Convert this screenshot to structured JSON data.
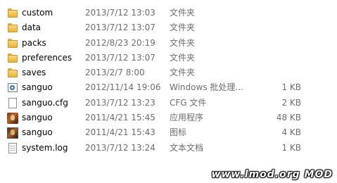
{
  "files": [
    {
      "name": "custom",
      "date": "2013/7/12 13:03",
      "type": "文件夹",
      "size": "",
      "icon": "folder-icon"
    },
    {
      "name": "data",
      "date": "2013/7/12 13:07",
      "type": "文件夹",
      "size": "",
      "icon": "folder-icon"
    },
    {
      "name": "packs",
      "date": "2012/8/23 20:19",
      "type": "文件夹",
      "size": "",
      "icon": "folder-icon"
    },
    {
      "name": "preferences",
      "date": "2013/7/12 13:07",
      "type": "文件夹",
      "size": "",
      "icon": "folder-icon"
    },
    {
      "name": "saves",
      "date": "2013/2/7 8:00",
      "type": "文件夹",
      "size": "",
      "icon": "folder-icon"
    },
    {
      "name": "sanguo",
      "date": "2012/11/14 19:06",
      "type": "Windows 批处理...",
      "size": "1 KB",
      "icon": "batch-icon"
    },
    {
      "name": "sanguo.cfg",
      "date": "2013/7/12 13:23",
      "type": "CFG 文件",
      "size": "2 KB",
      "icon": "blank-doc-icon"
    },
    {
      "name": "sanguo",
      "date": "2011/4/21 15:45",
      "type": "应用程序",
      "size": "48 KB",
      "icon": "app-icon"
    },
    {
      "name": "sanguo",
      "date": "2011/4/21 15:43",
      "type": "图标",
      "size": "4 KB",
      "icon": "image-icon"
    },
    {
      "name": "system.log",
      "date": "2013/7/12 13:24",
      "type": "文本文档",
      "size": "1 KB",
      "icon": "doc-icon"
    }
  ],
  "watermark": "www.lmod.org   MOD"
}
